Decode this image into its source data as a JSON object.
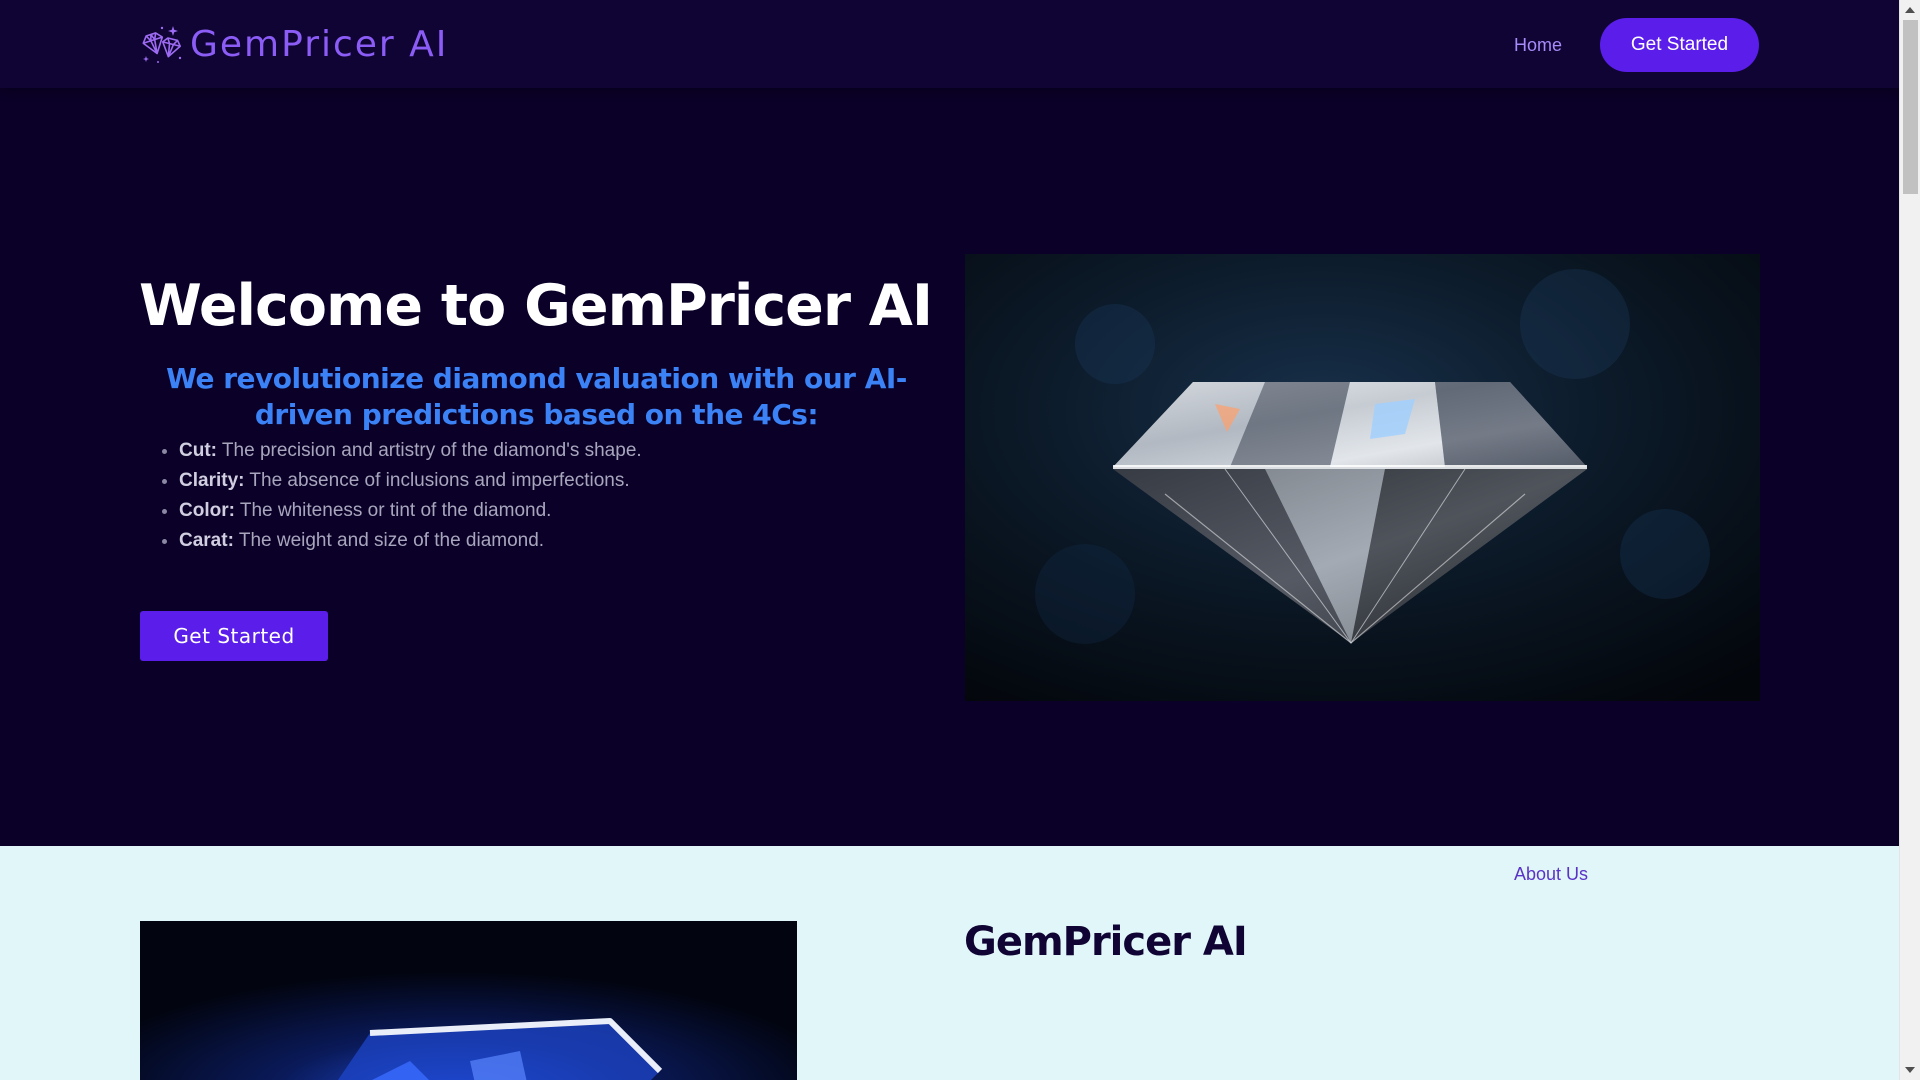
{
  "nav": {
    "brand": "GemPricer AI",
    "logo_icon": "diamonds-logo-icon",
    "links": [
      {
        "label": "Home"
      },
      {
        "label": "About Us"
      }
    ],
    "cta_label": "Get Started"
  },
  "hero": {
    "title": "Welcome to GemPricer AI",
    "subtitle": "We revolutionize diamond valuation with our AI-driven predictions based on the 4Cs:",
    "features": [
      {
        "term": "Cut:",
        "desc": " The precision and artistry of the diamond's shape."
      },
      {
        "term": "Clarity:",
        "desc": " The absence of inclusions and imperfections."
      },
      {
        "term": "Color:",
        "desc": " The whiteness or tint of the diamond."
      },
      {
        "term": "Carat:",
        "desc": " The weight and size of the diamond."
      }
    ],
    "cta_label": "Get Started",
    "image_alt": "diamond-image"
  },
  "about": {
    "title": "GemPricer AI",
    "image_alt": "blue-diamond-image"
  },
  "colors": {
    "background": "#0b0128",
    "navbar": "#0f0433",
    "accent": "#5b1eea",
    "subtitle": "#3b82f6",
    "section_light": "#e1f6f8"
  }
}
